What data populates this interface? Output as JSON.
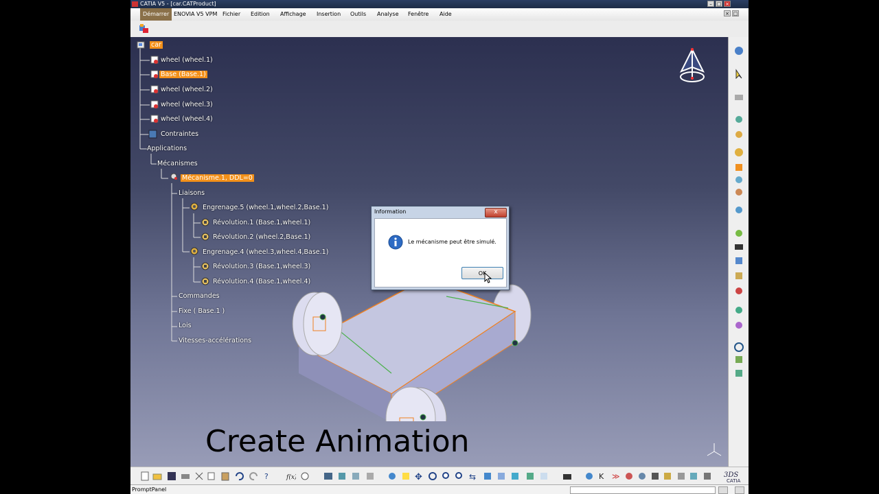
{
  "window": {
    "title": "CATIA V5 - [car.CATProduct]"
  },
  "menu": {
    "start": "Démarrer",
    "items": [
      "ENOVIA V5 VPM",
      "Fichier",
      "Edition",
      "Affichage",
      "Insertion",
      "Outils",
      "Analyse",
      "Fenêtre",
      "Aide"
    ]
  },
  "tree": {
    "root": "car",
    "wheel1": "wheel (wheel.1)",
    "base": "Base (Base.1)",
    "wheel2": "wheel (wheel.2)",
    "wheel3": "wheel (wheel.3)",
    "wheel4": "wheel (wheel.4)",
    "constraints": "Contraintes",
    "applications": "Applications",
    "mechanisms": "Mécanismes",
    "mechanism": "Mécanisme.1, DDL=0",
    "joints": "Liaisons",
    "gear5": "Engrenage.5 (wheel.1,wheel.2,Base.1)",
    "rev1": "Révolution.1 (Base.1,wheel.1)",
    "rev2": "Révolution.2 (wheel.2,Base.1)",
    "gear4": "Engrenage.4 (wheel.3,wheel.4,Base.1)",
    "rev3": "Révolution.3 (Base.1,wheel.3)",
    "rev4": "Révolution.4 (Base.1,wheel.4)",
    "commands": "Commandes",
    "fixed": "Fixe ( Base.1 )",
    "laws": "Lois",
    "speeds": "Vitesses-accélérations"
  },
  "dialog": {
    "title": "Information",
    "close": "x",
    "message": "Le mécanisme peut être simulé.",
    "ok": "OK"
  },
  "overlay": {
    "caption": "Create Animation"
  },
  "status": {
    "prompt": "PromptPanel"
  },
  "colors": {
    "highlight": "#f39019",
    "background_top": "#2c3050",
    "background_bottom": "#989cb7"
  }
}
